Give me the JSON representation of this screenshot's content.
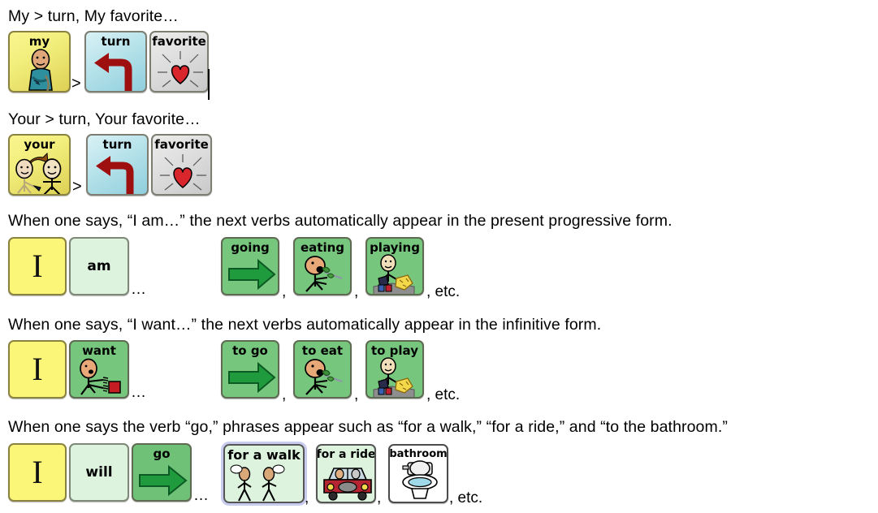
{
  "document": {
    "title": "AAC symbol grammar examples",
    "background": "#ffffff"
  },
  "rows": [
    {
      "id": "row-my-turn",
      "caption": "My > turn, My favorite…",
      "separator": ">",
      "trailing": "",
      "cards": [
        {
          "label": "my",
          "icon": "person-pointing-self",
          "color": "#f2ee7c",
          "style": "yellow-gradient"
        },
        {
          "label": "turn",
          "icon": "left-turn-arrow",
          "color": "#b6e2ea",
          "style": "blue-gradient"
        },
        {
          "label": "favorite",
          "icon": "shining-heart",
          "color": "#dedede",
          "style": "gray-gradient"
        }
      ]
    },
    {
      "id": "row-your-turn",
      "caption": "Your > turn, Your favorite…",
      "separator": ">",
      "trailing": "",
      "cards": [
        {
          "label": "your",
          "icon": "person-pointing-other",
          "color": "#f2ee7c",
          "style": "yellow-gradient"
        },
        {
          "label": "turn",
          "icon": "left-turn-arrow",
          "color": "#b6e2ea",
          "style": "blue-gradient"
        },
        {
          "label": "favorite",
          "icon": "shining-heart",
          "color": "#dedede",
          "style": "gray-gradient"
        }
      ]
    },
    {
      "id": "row-i-am",
      "caption": "When one says, “I am…” the next verbs automatically appear in the present progressive form.",
      "ellipsis": "…",
      "comma": ",",
      "trailing": ", etc.",
      "cards": [
        {
          "label": "I",
          "icon": "letter-i",
          "color": "#fbf678",
          "style": "flat-yellow"
        },
        {
          "label": "am",
          "icon": "word-only",
          "color": "#ddf3de",
          "style": "mint"
        },
        {
          "label": "going",
          "icon": "right-arrow",
          "color": "#77c67d",
          "style": "green"
        },
        {
          "label": "eating",
          "icon": "person-eating",
          "color": "#77c67d",
          "style": "green"
        },
        {
          "label": "playing",
          "icon": "person-playing",
          "color": "#77c67d",
          "style": "green"
        }
      ]
    },
    {
      "id": "row-i-want",
      "caption": "When one says, “I want…” the next verbs automatically appear in the infinitive form.",
      "ellipsis": "…",
      "comma": ",",
      "trailing": ", etc.",
      "cards": [
        {
          "label": "I",
          "icon": "letter-i",
          "color": "#fbf678",
          "style": "flat-yellow"
        },
        {
          "label": "want",
          "icon": "person-wanting",
          "color": "#77c67d",
          "style": "green"
        },
        {
          "label": "to go",
          "icon": "right-arrow",
          "color": "#77c67d",
          "style": "green"
        },
        {
          "label": "to eat",
          "icon": "person-eating",
          "color": "#77c67d",
          "style": "green"
        },
        {
          "label": "to play",
          "icon": "person-playing",
          "color": "#77c67d",
          "style": "green"
        }
      ]
    },
    {
      "id": "row-i-will-go",
      "caption": "When one says the verb “go,” phrases appear such as “for a walk,” “for a ride,” and “to the bathroom.”",
      "ellipsis": "…",
      "comma": ",",
      "trailing": ", etc.",
      "cards": [
        {
          "label": "I",
          "icon": "letter-i",
          "color": "#fbf678",
          "style": "flat-yellow"
        },
        {
          "label": "will",
          "icon": "word-only",
          "color": "#ddf3de",
          "style": "mint"
        },
        {
          "label": "go",
          "icon": "right-arrow",
          "color": "#6fc178",
          "style": "green-mid"
        },
        {
          "label": "for a walk",
          "icon": "two-people-walking-talking",
          "color": "#ddf3de",
          "style": "mint",
          "selected": true
        },
        {
          "label": "for a ride",
          "icon": "car-with-people",
          "color": "#ddf3de",
          "style": "mint"
        },
        {
          "label": "bathroom",
          "icon": "toilet",
          "color": "#ffffff",
          "style": "white"
        }
      ]
    }
  ],
  "punctuation": {
    "ellipsis": "…",
    "comma": ",",
    "etc": ", etc.",
    "gt": ">"
  }
}
